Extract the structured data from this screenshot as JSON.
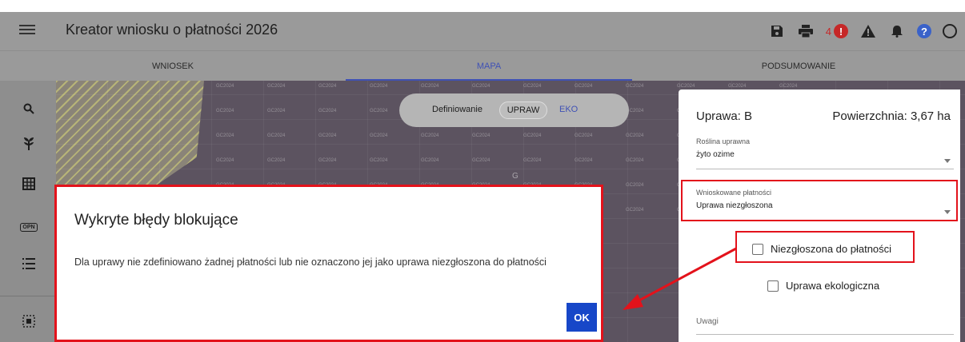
{
  "app": {
    "title": "Kreator wniosku o płatności 2026"
  },
  "topbar": {
    "icons": [
      "menu-icon",
      "save-icon",
      "print-icon",
      "error-icon",
      "warning-icon",
      "bell-icon",
      "help-icon",
      "account-icon"
    ],
    "error_count": "4",
    "error_mark": "!",
    "help_mark": "?"
  },
  "tabs": [
    {
      "label": "WNIOSEK",
      "active": false
    },
    {
      "label": "MAPA",
      "active": true
    },
    {
      "label": "PODSUMOWANIE",
      "active": false
    }
  ],
  "sidebar": {
    "icons": [
      "search-icon",
      "plant-icon",
      "grid-icon",
      "opn-icon",
      "list-icon",
      "select-area-icon"
    ],
    "opn_text": "OPN"
  },
  "map": {
    "mode_label": "Definiowanie",
    "mode_active": "UPRAW",
    "mode_other": "EKO",
    "cell_label": "GC2024",
    "marker_label": "G"
  },
  "panel": {
    "title": "Uprawa: B",
    "area": "Powierzchnia: 3,67 ha",
    "crop_label": "Roślina uprawna",
    "crop_value": "żyto ozime",
    "payments_label": "Wnioskowane płatności",
    "payments_value": "Uprawa niezgłoszona",
    "checkbox_not_reported": "Niezgłoszona do płatności",
    "checkbox_organic": "Uprawa ekologiczna",
    "notes_label": "Uwagi"
  },
  "dialog": {
    "title": "Wykryte błędy blokujące",
    "message": "Dla uprawy nie zdefiniowano żadnej płatności lub nie oznaczono jej jako uprawa niezgłoszona do płatności",
    "ok_label": "OK"
  },
  "colors": {
    "accent": "#3f51b5",
    "error": "#c62828",
    "highlight": "#e3121b",
    "ok_button": "#1747c8"
  }
}
